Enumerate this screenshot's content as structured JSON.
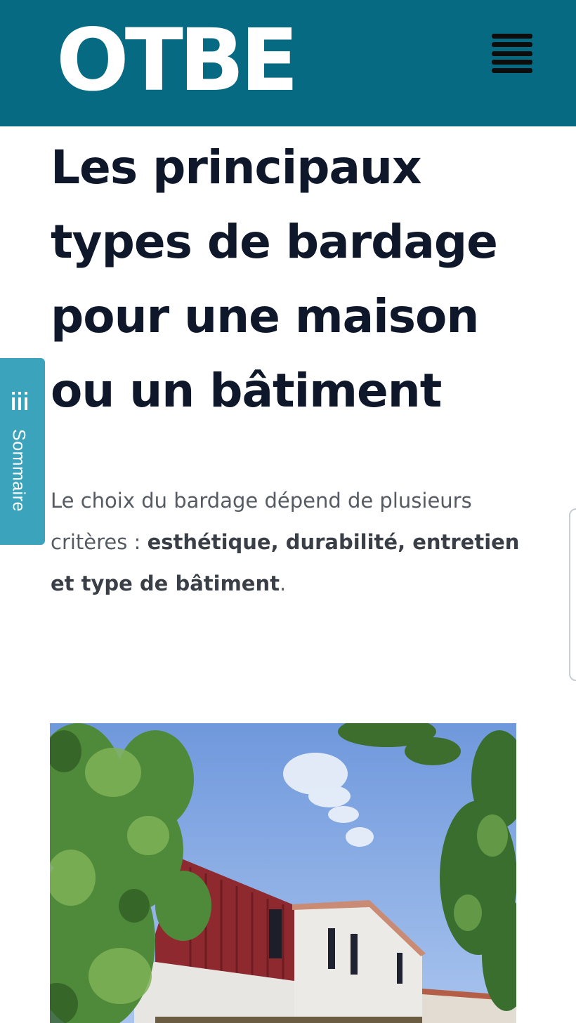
{
  "header": {
    "logo_text": "OTBE",
    "menu_icon": "hamburger-icon",
    "colors": {
      "background": "#056a82",
      "logo": "#ffffff",
      "menu": "#0d0d0d"
    }
  },
  "article": {
    "title": "Les principaux types de bardage pour une maison ou un bâtiment",
    "intro": {
      "lead": "Le choix du bardage dépend de plusieurs critères : ",
      "bold": "esthétique, durabilité, entretien et type de bâtiment",
      "end": "."
    },
    "title_color": "#0f172a",
    "body_color": "#555a63"
  },
  "sidebar_tab": {
    "label": "Sommaire",
    "icon": "list-icon",
    "color": "#3ba3bb"
  },
  "hero_image": {
    "subject": "modern house with red metal cladding and white render among trees"
  }
}
